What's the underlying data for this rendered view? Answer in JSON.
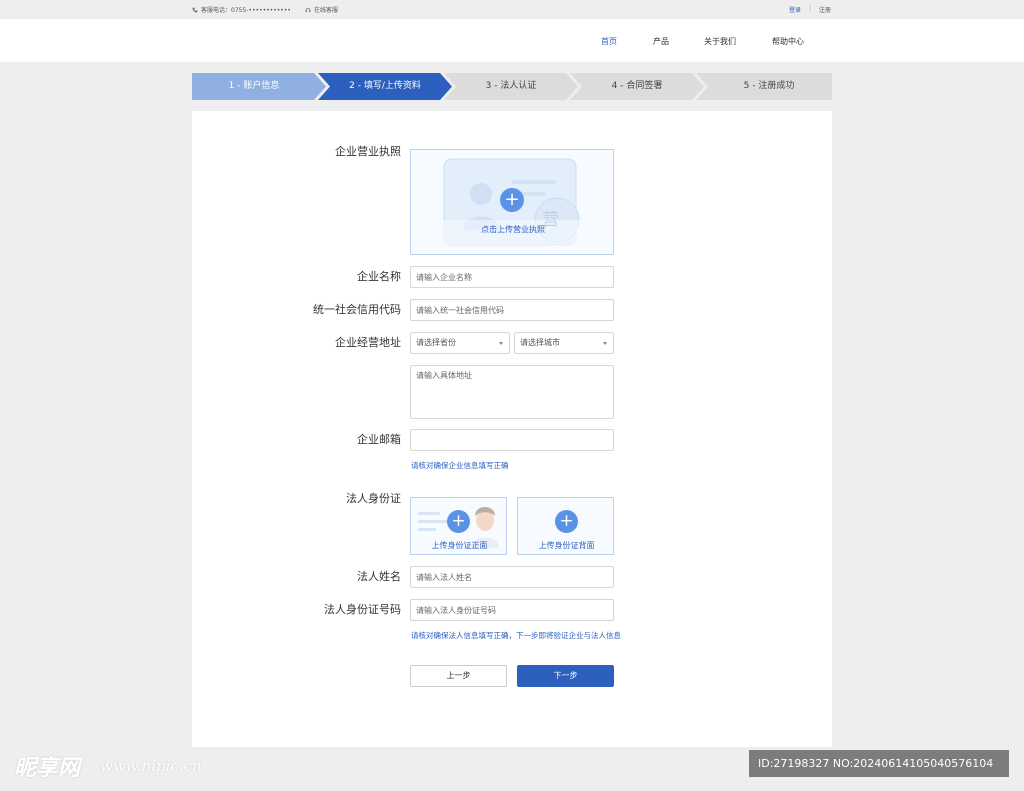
{
  "topbar": {
    "phone": "客服电话：0755-••••••••••••",
    "service": "在线客服",
    "login": "登录",
    "separator": "|",
    "register": "注册"
  },
  "nav": {
    "items": [
      {
        "label": "首页",
        "active": true
      },
      {
        "label": "产品"
      },
      {
        "label": "关于我们"
      },
      {
        "label": "帮助中心"
      }
    ]
  },
  "steps": [
    {
      "label": "1 - 账户信息",
      "state": "done"
    },
    {
      "label": "2 - 填写/上传资料",
      "state": "active"
    },
    {
      "label": "3 - 法人认证",
      "state": "todo"
    },
    {
      "label": "4 - 合同签署",
      "state": "todo"
    },
    {
      "label": "5 - 注册成功",
      "state": "todo"
    }
  ],
  "colors": {
    "accent": "#2d5fbf",
    "step_done": "#8fb0e0",
    "step_active": "#2d5fbf",
    "step_todo": "#dcdcdc"
  },
  "form": {
    "license_label": "企业营业执照",
    "license_upload": "点击上传营业执照",
    "license_badge": "营",
    "name_label": "企业名称",
    "name_placeholder": "请输入企业名称",
    "credit_label": "统一社会信用代码",
    "credit_placeholder": "请输入统一社会信用代码",
    "address_label": "企业经营地址",
    "province_select": "请选择省份",
    "city_select": "请选择城市",
    "address_placeholder": "请输入具体地址",
    "email_label": "企业邮箱",
    "email_value": "",
    "company_hint": "请核对确保企业信息填写正确",
    "id_label": "法人身份证",
    "id_front": "上传身份证正面",
    "id_back": "上传身份证背面",
    "legal_name_label": "法人姓名",
    "legal_name_placeholder": "请输入法人姓名",
    "legal_id_label": "法人身份证号码",
    "legal_id_placeholder": "请输入法人身份证号码",
    "legal_hint": "请核对确保法人信息填写正确，下一步即将验证企业与法人信息",
    "prev_button": "上一步",
    "next_button": "下一步"
  },
  "watermark": {
    "logo": "昵享网",
    "url": "www.nipic.cn",
    "id_text": "ID:27198327 NO:20240614105040576104"
  }
}
